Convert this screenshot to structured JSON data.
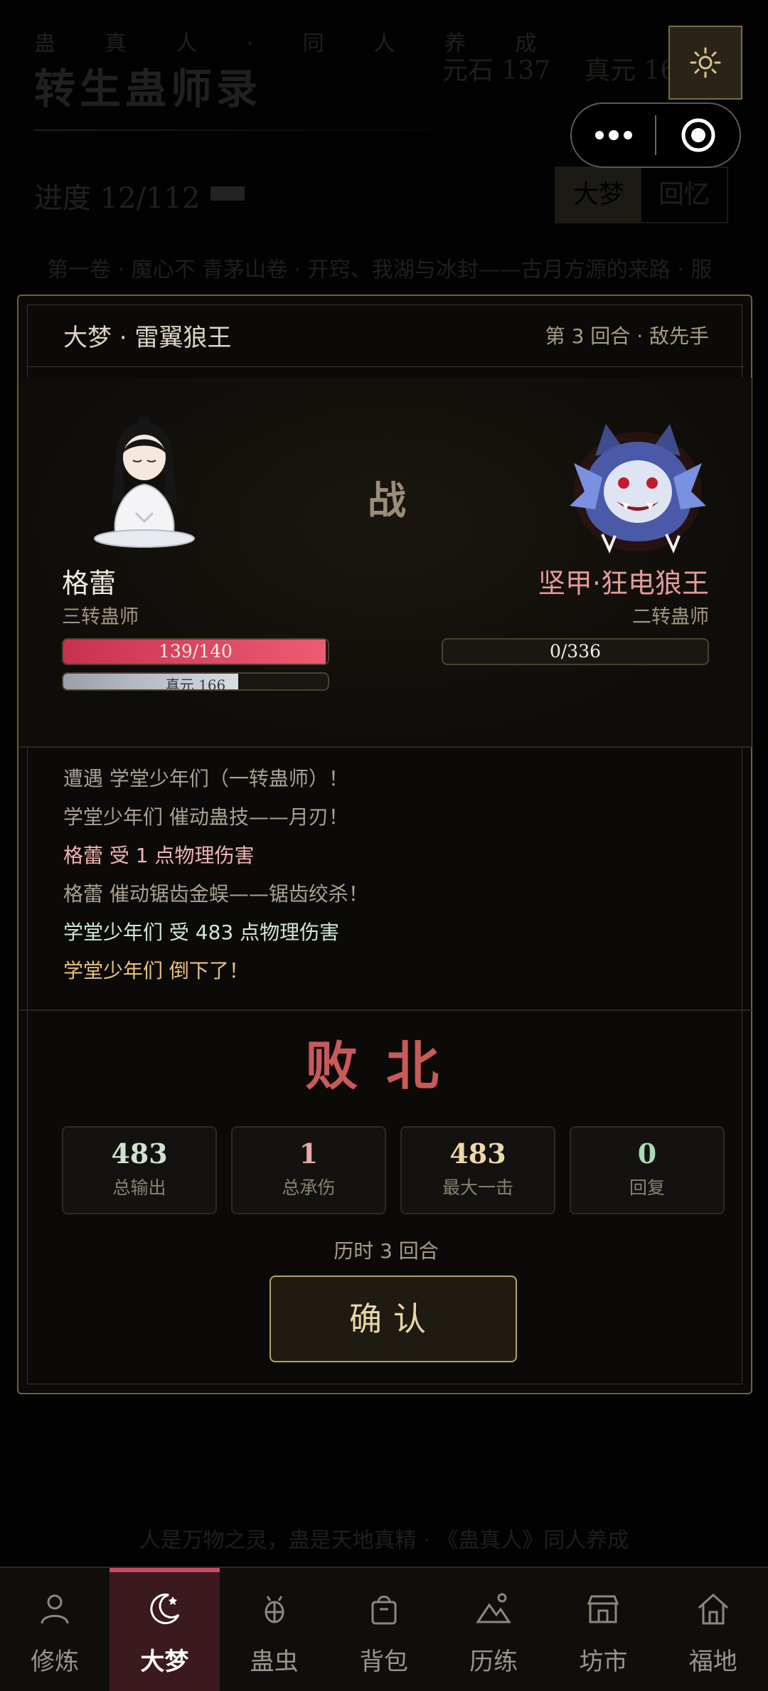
{
  "background": {
    "subtitle": "蛊 真 人 · 同 人 养 成",
    "title": "转生蛊师录",
    "yuanshi": "元石 137",
    "zhenyuan": "真元 16",
    "progress": "进度 12/112",
    "tabs": [
      "大梦",
      "回忆"
    ],
    "chapter": "第一卷 · 魔心不   青茅山卷 · 开窍、我湖与冰封——古月方源的来路 · 服",
    "footer": "人是万物之灵，蛊是天地真精 · 《蛊真人》同人养成"
  },
  "battle": {
    "title": "大梦 · 雷翼狼王",
    "round_info": "第 3 回合 · 敌先手",
    "vs": "战",
    "player": {
      "name": "格蕾",
      "rank": "三转蛊师",
      "hp": "139/140",
      "hp_fraction": 0.993,
      "mp": "真元 166",
      "mp_fraction": 0.66
    },
    "enemy": {
      "name": "坚甲·狂电狼王",
      "rank": "二转蛊师",
      "hp": "0/336",
      "hp_fraction": 0
    },
    "log": [
      {
        "text": "遭遇 学堂少年们（一转蛊师）！",
        "color": "#a9a092"
      },
      {
        "text": "学堂少年们 催动蛊技——月刃！",
        "color": "#a9a092"
      },
      {
        "text": "格蕾 受 1 点物理伤害",
        "color": "#f0b3b3"
      },
      {
        "text": "格蕾 催动锯齿金蜈——锯齿绞杀！",
        "color": "#a9a092"
      },
      {
        "text": "学堂少年们 受 483 点物理伤害",
        "color": "#cfe8d6"
      },
      {
        "text": "学堂少年们 倒下了！",
        "color": "#e8c27a"
      }
    ],
    "result": "败北",
    "stats": [
      {
        "value": "483",
        "label": "总输出",
        "color": "#cfe3d0"
      },
      {
        "value": "1",
        "label": "总承伤",
        "color": "#e8aaaa"
      },
      {
        "value": "483",
        "label": "最大一击",
        "color": "#eed8a8"
      },
      {
        "value": "0",
        "label": "回复",
        "color": "#a8dcb4"
      }
    ],
    "duration": "历时 3 回合",
    "confirm": "确认"
  },
  "nav": [
    {
      "label": "修炼",
      "icon": "person-icon"
    },
    {
      "label": "大梦",
      "icon": "moon-icon",
      "active": true
    },
    {
      "label": "蛊虫",
      "icon": "bug-icon"
    },
    {
      "label": "背包",
      "icon": "bag-icon"
    },
    {
      "label": "历练",
      "icon": "mountain-icon"
    },
    {
      "label": "坊市",
      "icon": "shop-icon"
    },
    {
      "label": "福地",
      "icon": "home-icon"
    }
  ]
}
